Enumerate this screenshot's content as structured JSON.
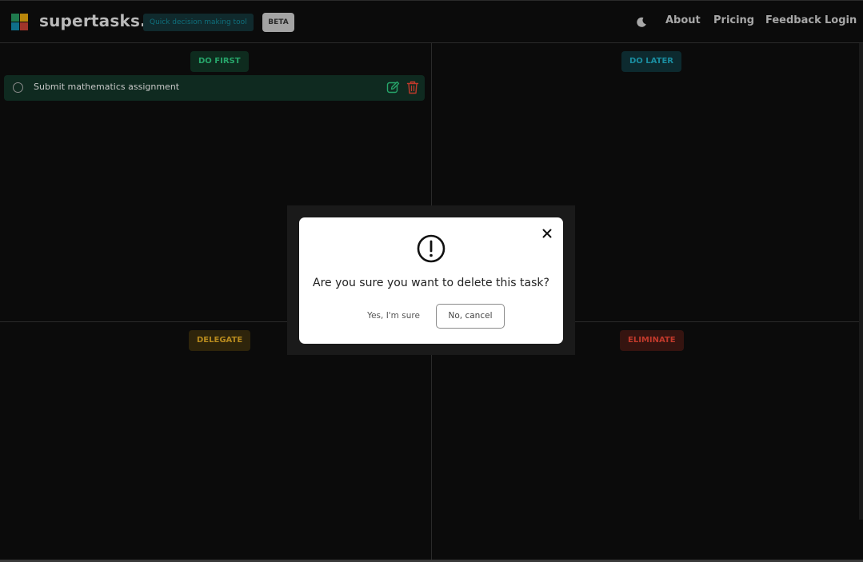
{
  "header": {
    "brand": "supertasks.io",
    "tagline": "Quick decision making tool",
    "badge": "BETA",
    "nav": [
      "About",
      "Pricing",
      "Feedback",
      "Login"
    ],
    "theme_icon": "moon-icon",
    "logo_colors": [
      "#1f7a4d",
      "#b8860b",
      "#0f6f8a",
      "#a0352a"
    ]
  },
  "quadrants": [
    {
      "label": "DO FIRST",
      "color": "#27a56a",
      "bg": "#0e2b1e"
    },
    {
      "label": "DO LATER",
      "color": "#1a8da0",
      "bg": "#0d2a2f"
    },
    {
      "label": "DELEGATE",
      "color": "#b78a1e",
      "bg": "#2e240b"
    },
    {
      "label": "ELIMINATE",
      "color": "#c0392b",
      "bg": "#351410"
    }
  ],
  "tasks": [
    {
      "text": "Submit mathematics assignment",
      "quadrant": "DO FIRST"
    }
  ],
  "modal": {
    "message": "Are you sure you want to delete this task?",
    "confirm": "Yes, I'm sure",
    "cancel": "No, cancel",
    "icon": "alert-circle-icon",
    "close_icon": "close-icon"
  }
}
